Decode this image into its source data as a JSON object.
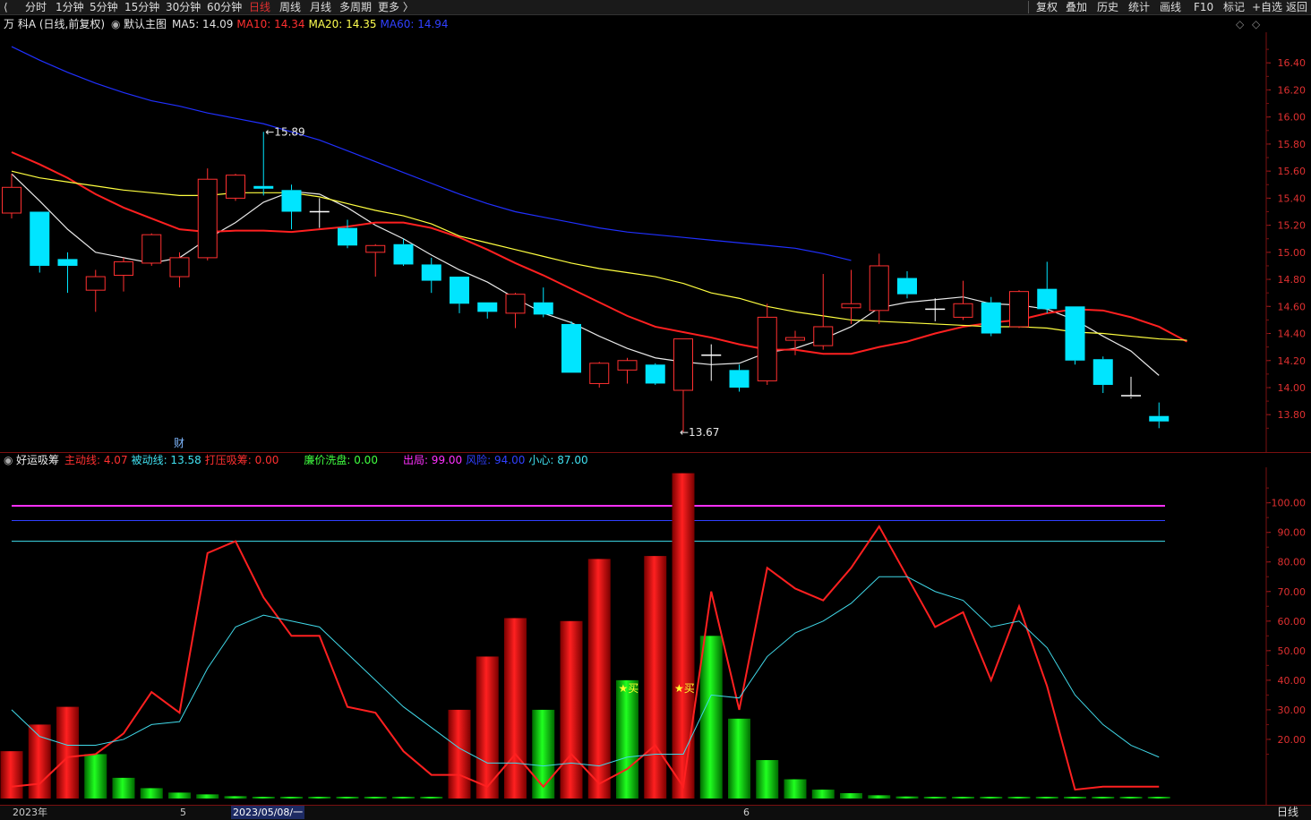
{
  "toolbar": {
    "left_items": [
      "分时",
      "1分钟",
      "5分钟",
      "15分钟",
      "30分钟",
      "60分钟",
      "日线",
      "周线",
      "月线",
      "多周期",
      "更多 〉"
    ],
    "active": "日线",
    "right_items": [
      "复权",
      "叠加",
      "历史",
      "统计",
      "画线",
      "F10",
      "标记",
      "+自选",
      "返回"
    ]
  },
  "main_legend": {
    "stock": "万 科A (日线,前复权)",
    "template": "默认主图",
    "ma": [
      {
        "label": "MA5: 14.09",
        "color": "#e0e0e0"
      },
      {
        "label": "MA10: 14.34",
        "color": "#ff3030"
      },
      {
        "label": "MA20: 14.35",
        "color": "#ffff50"
      },
      {
        "label": "MA60: 14.94",
        "color": "#3040ff"
      }
    ]
  },
  "sub_legend": {
    "name": "好运吸筹",
    "items": [
      {
        "label": "主动线: 4.07",
        "color": "#ff3030"
      },
      {
        "label": "被动线: 13.58",
        "color": "#40e0f0"
      },
      {
        "label": "打压吸筹: 0.00",
        "color": "#ff3030"
      },
      {
        "label": "廉价洗盘: 0.00",
        "color": "#40ff40"
      },
      {
        "label": "出局: 99.00",
        "color": "#ff30ff"
      },
      {
        "label": "风险: 94.00",
        "color": "#3040ff"
      },
      {
        "label": "小心: 87.00",
        "color": "#40e0f0"
      }
    ]
  },
  "annotations": {
    "high": "15.89",
    "low": "13.67",
    "finance_marker": "财",
    "buy_signal": "★买"
  },
  "bottom": {
    "dates": [
      "2023年",
      "5",
      "2023/05/08/一",
      "6"
    ],
    "period": "日线"
  },
  "chart_data": [
    {
      "type": "candlestick",
      "yaxis_ticks": [
        13.8,
        14.0,
        14.2,
        14.4,
        14.6,
        14.8,
        15.0,
        15.2,
        15.4,
        15.6,
        15.8,
        16.0,
        16.2,
        16.4
      ],
      "ylim": [
        13.55,
        16.6
      ],
      "candles": [
        {
          "o": 15.29,
          "h": 15.58,
          "l": 15.25,
          "c": 15.48
        },
        {
          "o": 15.3,
          "h": 15.3,
          "l": 14.85,
          "c": 14.9
        },
        {
          "o": 14.95,
          "h": 15.0,
          "l": 14.7,
          "c": 14.9
        },
        {
          "o": 14.72,
          "h": 14.87,
          "l": 14.56,
          "c": 14.82
        },
        {
          "o": 14.83,
          "h": 14.96,
          "l": 14.71,
          "c": 14.93
        },
        {
          "o": 14.92,
          "h": 15.14,
          "l": 14.9,
          "c": 15.13
        },
        {
          "o": 14.82,
          "h": 15.0,
          "l": 14.74,
          "c": 14.96
        },
        {
          "o": 14.96,
          "h": 15.62,
          "l": 14.94,
          "c": 15.54
        },
        {
          "o": 15.4,
          "h": 15.58,
          "l": 15.38,
          "c": 15.57
        },
        {
          "o": 15.49,
          "h": 15.89,
          "l": 15.42,
          "c": 15.47
        },
        {
          "o": 15.46,
          "h": 15.5,
          "l": 15.17,
          "c": 15.3
        },
        {
          "o": 15.3,
          "h": 15.4,
          "l": 15.18,
          "c": 15.3
        },
        {
          "o": 15.18,
          "h": 15.24,
          "l": 15.03,
          "c": 15.05
        },
        {
          "o": 15.0,
          "h": 15.06,
          "l": 14.82,
          "c": 15.05
        },
        {
          "o": 15.06,
          "h": 15.1,
          "l": 14.9,
          "c": 14.91
        },
        {
          "o": 14.91,
          "h": 14.96,
          "l": 14.7,
          "c": 14.79
        },
        {
          "o": 14.82,
          "h": 14.82,
          "l": 14.55,
          "c": 14.62
        },
        {
          "o": 14.63,
          "h": 14.63,
          "l": 14.51,
          "c": 14.56
        },
        {
          "o": 14.55,
          "h": 14.7,
          "l": 14.44,
          "c": 14.69
        },
        {
          "o": 14.63,
          "h": 14.74,
          "l": 14.52,
          "c": 14.54
        },
        {
          "o": 14.47,
          "h": 14.49,
          "l": 14.11,
          "c": 14.11
        },
        {
          "o": 14.03,
          "h": 14.19,
          "l": 14.0,
          "c": 14.18
        },
        {
          "o": 14.13,
          "h": 14.22,
          "l": 14.03,
          "c": 14.2
        },
        {
          "o": 14.17,
          "h": 14.18,
          "l": 14.02,
          "c": 14.03
        },
        {
          "o": 13.98,
          "h": 14.36,
          "l": 13.67,
          "c": 14.36
        },
        {
          "o": 14.24,
          "h": 14.32,
          "l": 14.05,
          "c": 14.24
        },
        {
          "o": 14.13,
          "h": 14.17,
          "l": 13.97,
          "c": 14.0
        },
        {
          "o": 14.05,
          "h": 14.62,
          "l": 14.02,
          "c": 14.52
        },
        {
          "o": 14.35,
          "h": 14.42,
          "l": 14.24,
          "c": 14.37
        },
        {
          "o": 14.31,
          "h": 14.84,
          "l": 14.28,
          "c": 14.45
        },
        {
          "o": 14.59,
          "h": 14.87,
          "l": 14.47,
          "c": 14.62
        },
        {
          "o": 14.57,
          "h": 14.99,
          "l": 14.47,
          "c": 14.9
        },
        {
          "o": 14.81,
          "h": 14.86,
          "l": 14.66,
          "c": 14.69
        },
        {
          "o": 14.58,
          "h": 14.66,
          "l": 14.49,
          "c": 14.58
        },
        {
          "o": 14.52,
          "h": 14.79,
          "l": 14.5,
          "c": 14.62
        },
        {
          "o": 14.63,
          "h": 14.67,
          "l": 14.38,
          "c": 14.4
        },
        {
          "o": 14.45,
          "h": 14.72,
          "l": 14.44,
          "c": 14.71
        },
        {
          "o": 14.73,
          "h": 14.93,
          "l": 14.55,
          "c": 14.58
        },
        {
          "o": 14.6,
          "h": 14.6,
          "l": 14.17,
          "c": 14.2
        },
        {
          "o": 14.21,
          "h": 14.23,
          "l": 13.96,
          "c": 14.02
        },
        {
          "o": 13.94,
          "h": 14.08,
          "l": 13.92,
          "c": 13.93
        },
        {
          "o": 13.79,
          "h": 13.89,
          "l": 13.7,
          "c": 13.75
        }
      ],
      "series": [
        {
          "name": "MA5",
          "color": "#e8e8e8",
          "values": [
            15.58,
            15.38,
            15.17,
            15.0,
            14.96,
            14.92,
            14.96,
            15.1,
            15.22,
            15.37,
            15.45,
            15.43,
            15.33,
            15.2,
            15.1,
            14.98,
            14.87,
            14.78,
            14.66,
            14.55,
            14.48,
            14.38,
            14.29,
            14.22,
            14.19,
            14.17,
            14.18,
            14.26,
            14.29,
            14.36,
            14.45,
            14.59,
            14.63,
            14.65,
            14.67,
            14.62,
            14.61,
            14.58,
            14.5,
            14.38,
            14.27,
            14.09
          ]
        },
        {
          "name": "MA10",
          "color": "#ff2020",
          "values": [
            15.74,
            15.65,
            15.55,
            15.43,
            15.33,
            15.25,
            15.17,
            15.15,
            15.16,
            15.16,
            15.15,
            15.17,
            15.19,
            15.22,
            15.22,
            15.18,
            15.11,
            15.02,
            14.92,
            14.83,
            14.73,
            14.63,
            14.53,
            14.45,
            14.41,
            14.37,
            14.32,
            14.28,
            14.28,
            14.25,
            14.25,
            14.3,
            14.34,
            14.4,
            14.45,
            14.48,
            14.5,
            14.55,
            14.58,
            14.57,
            14.52,
            14.45,
            14.34
          ]
        },
        {
          "name": "MA20",
          "color": "#ffff40",
          "values": [
            15.6,
            15.55,
            15.52,
            15.49,
            15.46,
            15.44,
            15.42,
            15.42,
            15.44,
            15.44,
            15.44,
            15.41,
            15.36,
            15.31,
            15.27,
            15.21,
            15.12,
            15.07,
            15.02,
            14.97,
            14.92,
            14.88,
            14.85,
            14.82,
            14.77,
            14.7,
            14.66,
            14.6,
            14.56,
            14.53,
            14.5,
            14.49,
            14.48,
            14.47,
            14.46,
            14.45,
            14.45,
            14.44,
            14.41,
            14.4,
            14.38,
            14.36,
            14.35
          ]
        },
        {
          "name": "MA60",
          "color": "#2030ff",
          "values": [
            16.52,
            16.42,
            16.33,
            16.25,
            16.18,
            16.12,
            16.08,
            16.03,
            15.99,
            15.95,
            15.89,
            15.83,
            15.75,
            15.67,
            15.59,
            15.51,
            15.43,
            15.36,
            15.3,
            15.26,
            15.22,
            15.18,
            15.15,
            15.13,
            15.11,
            15.09,
            15.07,
            15.05,
            15.03,
            14.99,
            14.94
          ]
        }
      ]
    },
    {
      "type": "bar",
      "ylim": [
        0,
        112
      ],
      "yaxis_ticks": [
        20,
        30,
        40,
        50,
        60,
        70,
        80,
        90,
        100
      ],
      "thresholds": [
        {
          "name": "出局",
          "value": 99,
          "color": "#ff30ff"
        },
        {
          "name": "风险",
          "value": 94,
          "color": "#3040ff"
        },
        {
          "name": "小心",
          "value": 87,
          "color": "#40e0f0"
        }
      ],
      "bars": [
        {
          "v": 16,
          "c": "red"
        },
        {
          "v": 25,
          "c": "red"
        },
        {
          "v": 31,
          "c": "red"
        },
        {
          "v": 15,
          "c": "green"
        },
        {
          "v": 7,
          "c": "green"
        },
        {
          "v": 3.5,
          "c": "green"
        },
        {
          "v": 2,
          "c": "green"
        },
        {
          "v": 1.4,
          "c": "green"
        },
        {
          "v": 0.8,
          "c": "green"
        },
        {
          "v": 0.6,
          "c": "green"
        },
        {
          "v": 0.4,
          "c": "green"
        },
        {
          "v": 0.3,
          "c": "green"
        },
        {
          "v": 0.2,
          "c": "green"
        },
        {
          "v": 0.2,
          "c": "green"
        },
        {
          "v": 0.2,
          "c": "green"
        },
        {
          "v": 0.2,
          "c": "green"
        },
        {
          "v": 30,
          "c": "red"
        },
        {
          "v": 48,
          "c": "red"
        },
        {
          "v": 61,
          "c": "red"
        },
        {
          "v": 30,
          "c": "green"
        },
        {
          "v": 60,
          "c": "red"
        },
        {
          "v": 81,
          "c": "red"
        },
        {
          "v": 40,
          "c": "green"
        },
        {
          "v": 82,
          "c": "red"
        },
        {
          "v": 110,
          "c": "red"
        },
        {
          "v": 55,
          "c": "green"
        },
        {
          "v": 27,
          "c": "green"
        },
        {
          "v": 13,
          "c": "green"
        },
        {
          "v": 6.5,
          "c": "green"
        },
        {
          "v": 3,
          "c": "green"
        },
        {
          "v": 1.8,
          "c": "green"
        },
        {
          "v": 1.1,
          "c": "green"
        },
        {
          "v": 0.7,
          "c": "green"
        },
        {
          "v": 0.5,
          "c": "green"
        },
        {
          "v": 0.4,
          "c": "green"
        },
        {
          "v": 0.3,
          "c": "green"
        },
        {
          "v": 0.2,
          "c": "green"
        },
        {
          "v": 0.2,
          "c": "green"
        },
        {
          "v": 0.2,
          "c": "green"
        },
        {
          "v": 0.2,
          "c": "green"
        },
        {
          "v": 0.2,
          "c": "green"
        },
        {
          "v": 0.2,
          "c": "green"
        }
      ],
      "series": [
        {
          "name": "主动线",
          "color": "#ff2020",
          "values": [
            4,
            5,
            14,
            15,
            22,
            36,
            29,
            83,
            87,
            68,
            55,
            55,
            31,
            29,
            16,
            8,
            8,
            4,
            15,
            4,
            15,
            5,
            10,
            18,
            4,
            70,
            30,
            78,
            71,
            67,
            78,
            92,
            75,
            58,
            63,
            40,
            65,
            38,
            3,
            4,
            4,
            4
          ]
        },
        {
          "name": "被动线",
          "color": "#40d8e8",
          "values": [
            30,
            21,
            18,
            18,
            20,
            25,
            26,
            44,
            58,
            62,
            60,
            58,
            49,
            40,
            31,
            24,
            17,
            12,
            12,
            11,
            12,
            11,
            14,
            15,
            15,
            35,
            34,
            48,
            56,
            60,
            66,
            75,
            75,
            70,
            67,
            58,
            60,
            51,
            35,
            25,
            18,
            14
          ]
        }
      ],
      "buy_marks": [
        22,
        24
      ]
    }
  ]
}
